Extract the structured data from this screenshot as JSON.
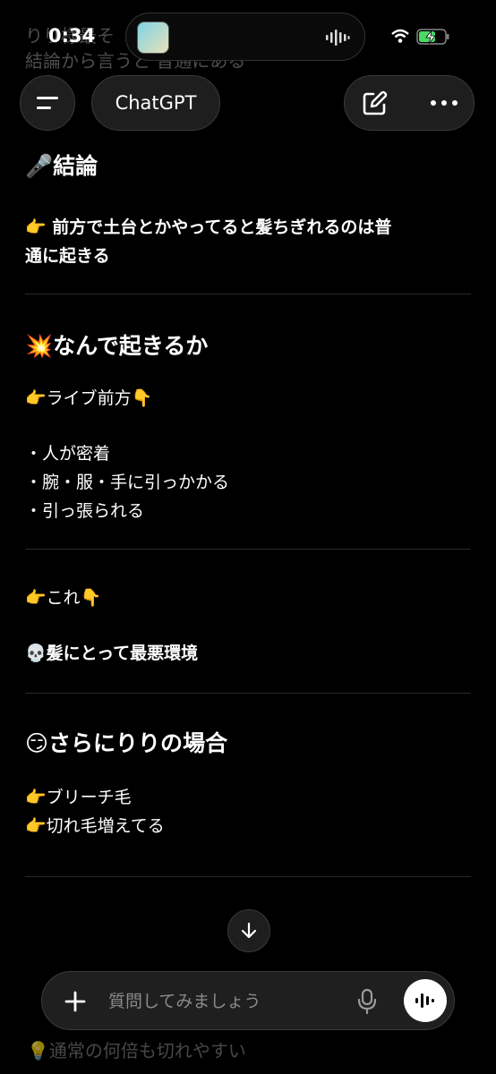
{
  "status": {
    "time": "0:34"
  },
  "background_prev_text": {
    "line1": "りり様最そ",
    "line2": "結論から言うと 普通にある"
  },
  "nav": {
    "title": "ChatGPT"
  },
  "content": {
    "sec1_heading": "🎤結論",
    "sec1_line1": "👉 前方で土台とかやってると髪ちぎれるのは普",
    "sec1_line2": "通に起きる",
    "sec2_heading": "💥なんで起きるか",
    "sec2_sub": "👉ライブ前方👇",
    "sec2_bullets": [
      "・人が密着",
      "・腕・服・手に引っかかる",
      "・引っ張られる"
    ],
    "sec3_sub": "👉これ👇",
    "sec3_emph": "💀髪にとって最悪環境",
    "sec4_heading": "😏さらにりりの場合",
    "sec4_lines": [
      "👉ブリーチ毛",
      "👉切れ毛増えてる"
    ],
    "sec5_faded": "💡通常の何倍も切れやすい"
  },
  "composer": {
    "placeholder": "質問してみましょう"
  },
  "colors": {
    "background": "#000000",
    "pill": "#1e1e1e",
    "battery_green": "#4cd964"
  },
  "icons": [
    "menu-icon",
    "edit-icon",
    "more-icon",
    "arrow-down-icon",
    "plus-icon",
    "mic-icon",
    "voice-wave-icon",
    "wifi-icon",
    "battery-icon"
  ]
}
